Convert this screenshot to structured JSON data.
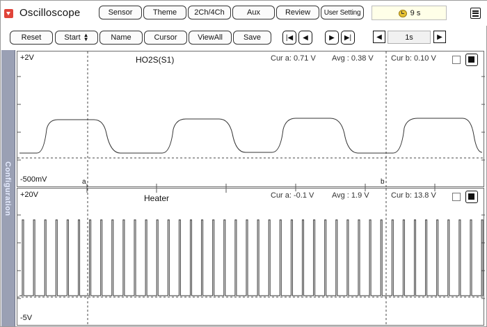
{
  "app": {
    "title": "Oscilloscope"
  },
  "toolbar": {
    "sensor": "Sensor",
    "theme": "Theme",
    "channels": "2Ch/4Ch",
    "aux": "Aux",
    "review": "Review",
    "user_setting": "User Setting",
    "timer": "9 s"
  },
  "toolbar2": {
    "reset": "Reset",
    "start": "Start",
    "name": "Name",
    "cursor": "Cursor",
    "view_all": "ViewAll",
    "save": "Save",
    "timebase": "1s"
  },
  "sidebar": {
    "label": "Configuration"
  },
  "pane1": {
    "title": "HO2S(S1)",
    "top_label": "+2V",
    "bottom_label": "-500mV",
    "cur_a": "Cur a: 0.71 V",
    "avg": "Avg  : 0.38 V",
    "cur_b": "Cur b: 0.10 V",
    "marker_a": "a",
    "marker_b": "b"
  },
  "pane2": {
    "title": "Heater",
    "top_label": "+20V",
    "bottom_label": "-5V",
    "cur_a": "Cur a: -0.1 V",
    "avg": "Avg  : 1.9 V",
    "cur_b": "Cur b: 13.8 V"
  },
  "icons": {
    "menu": "dropdown-menu-icon",
    "clock": "clock-icon",
    "hamburger": "hamburger-menu-icon",
    "first": "skip-first-icon",
    "prev": "prev-icon",
    "next": "next-icon",
    "last": "skip-last-icon"
  },
  "colors": {
    "accent": "#e0443a",
    "sidebar": "#9aa0b4",
    "timer_bg": "#ffffe8"
  }
}
